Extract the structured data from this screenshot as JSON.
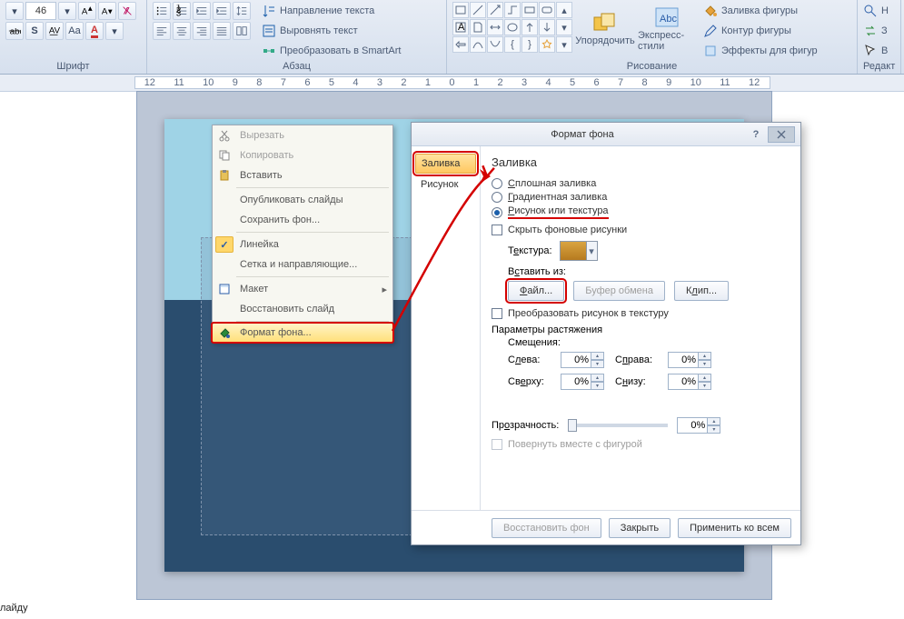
{
  "ribbon": {
    "font_size": "46",
    "groups": {
      "font": "Шрифт",
      "paragraph": "Абзац",
      "drawing": "Рисование",
      "editing": "Редакт"
    },
    "text_direction": "Направление текста",
    "align_text": "Выровнять текст",
    "smartart": "Преобразовать в SmartArt",
    "arrange": "Упорядочить",
    "express_styles": "Экспресс-стили",
    "shape_fill": "Заливка фигуры",
    "shape_outline": "Контур фигуры",
    "shape_effects": "Эффекты для фигур",
    "find": "Н",
    "replace": "З",
    "select": "В"
  },
  "ruler_marks": [
    "12",
    "11",
    "10",
    "9",
    "8",
    "7",
    "6",
    "5",
    "4",
    "3",
    "2",
    "1",
    "0",
    "1",
    "2",
    "3",
    "4",
    "5",
    "6",
    "7",
    "8",
    "9",
    "10",
    "11",
    "12"
  ],
  "ctx": {
    "cut": "Вырезать",
    "copy": "Копировать",
    "paste": "Вставить",
    "publish": "Опубликовать слайды",
    "save_bg": "Сохранить фон...",
    "ruler": "Линейка",
    "grid": "Сетка и направляющие...",
    "layout": "Макет",
    "restore": "Восстановить слайд",
    "format_bg": "Формат фона..."
  },
  "dlg": {
    "title": "Формат фона",
    "help": "?",
    "nav_fill": "Заливка",
    "nav_picture": "Рисунок",
    "section": "Заливка",
    "r_solid": "Сплошная заливка",
    "r_gradient": "Градиентная заливка",
    "r_picture": "Рисунок или текстура",
    "chk_hide": "Скрыть фоновые рисунки",
    "texture": "Текстура:",
    "insert_from": "Вставить из:",
    "btn_file": "Файл...",
    "btn_clip_brd": "Буфер обмена",
    "btn_clip": "Клип...",
    "chk_tile": "Преобразовать рисунок в текстуру",
    "stretch": "Параметры растяжения",
    "offsets": "Смещения:",
    "left": "Слева:",
    "right": "Справа:",
    "top": "Сверху:",
    "bottom": "Снизу:",
    "pct": "0%",
    "transparency": "Прозрачность:",
    "trans_val": "0%",
    "chk_rotate": "Повернуть вместе с фигурой",
    "btn_restore": "Восстановить фон",
    "btn_close": "Закрыть",
    "btn_apply_all": "Применить ко всем"
  },
  "footer_text": "лайду"
}
